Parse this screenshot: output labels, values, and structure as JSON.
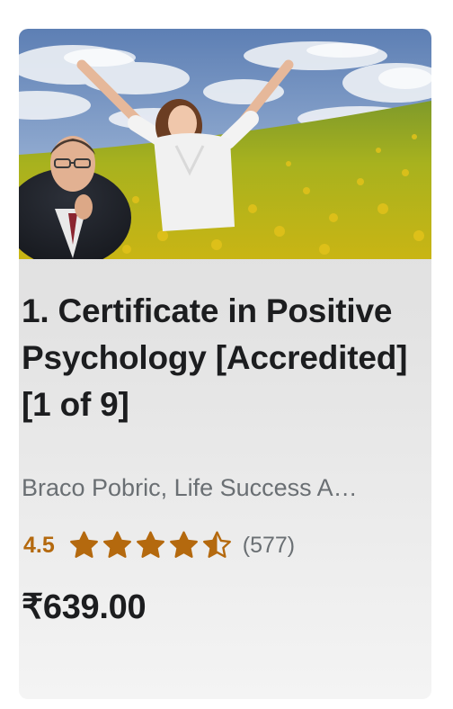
{
  "course": {
    "title": "1. Certificate in Positive Psychology [Accredited] [1 of 9]",
    "instructors": "Braco Pobric, Life Success A…",
    "rating": "4.5",
    "rating_stars": 4.5,
    "rating_count": "(577)",
    "price": "₹639.00",
    "thumbnail": {
      "subject": "woman-arms-raised-in-flower-field",
      "inset": "instructor-portrait"
    }
  },
  "colors": {
    "rating": "#b4690e",
    "title": "#1c1d1f",
    "muted": "#6a6f73"
  }
}
